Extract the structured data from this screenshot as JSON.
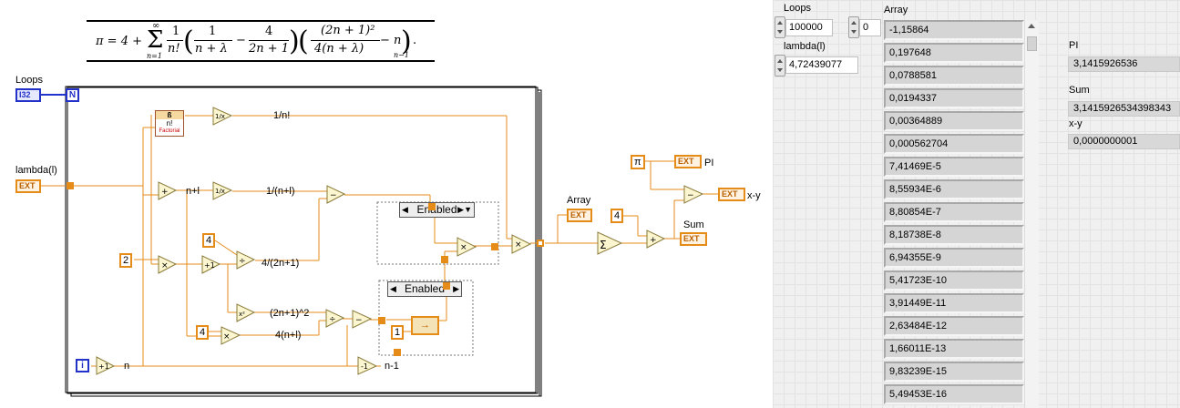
{
  "diagram": {
    "formula": {
      "lhs": "π = 4 + ",
      "sum_top": "∞",
      "sum_sym": "Σ",
      "sum_bottom": "n=1",
      "t1_num": "1",
      "t1_den": "n!",
      "t2_num": "1",
      "t2_den": "n + λ",
      "minus": "−",
      "t3_num": "4",
      "t3_den": "2n + 1",
      "t4_num": "(2n + 1)²",
      "t4_den": "4(n + λ)",
      "t4_tail": "− n",
      "sub": "n−1",
      "period": "."
    },
    "labels": {
      "loops": "Loops",
      "lambda": "lambda(l)",
      "i32": "I32",
      "n_term": "N",
      "ext": "EXT",
      "one_over_fact": "1/n!",
      "n_plus_l": "n+l",
      "one_over_nl": "1/(n+l)",
      "four_over": "4/(2n+1)",
      "sq": "(2n+1)^2",
      "four_nl": "4(n+l)",
      "n_label": "n",
      "n_minus_1": "n-1",
      "array": "Array",
      "pi_label": "PI",
      "sum_label": "Sum",
      "xy_label": "x-y",
      "pi_const": "π",
      "i_term": "i"
    },
    "constants": {
      "two": "2",
      "four_a": "4",
      "four_b": "4",
      "one": "1",
      "four_c": "4"
    },
    "nodes": {
      "add": "+",
      "mul": "×",
      "sub": "−",
      "div": "÷",
      "inv": "1/x",
      "inc": "+1",
      "dec": "-1",
      "sq": "x²",
      "sigma": "Σ"
    },
    "factorial": {
      "top": "ß",
      "mid": "n!",
      "bot": "Factorial"
    },
    "case_structures": [
      {
        "label": "Enabled"
      },
      {
        "label": "Enabled"
      }
    ]
  },
  "panel": {
    "loops_label": "Loops",
    "loops_value": "100000",
    "lambda_label": "lambda(l)",
    "lambda_value": "4,72439077",
    "array_label": "Array",
    "array_index": "0",
    "array": [
      "-1,15864",
      "0,197648",
      "0,0788581",
      "0,0194337",
      "0,00364889",
      "0,000562704",
      "7,41469E-5",
      "8,55934E-6",
      "8,80854E-7",
      "8,18738E-8",
      "6,94355E-9",
      "5,41723E-10",
      "3,91449E-11",
      "2,63484E-12",
      "1,66011E-13",
      "9,83239E-15",
      "5,49453E-16"
    ],
    "pi_label": "PI",
    "pi_value": "3,1415926536",
    "sum_label": "Sum",
    "sum_value": "3,1415926534398343",
    "xy_label": "x-y",
    "xy_value": "0,0000000001"
  }
}
